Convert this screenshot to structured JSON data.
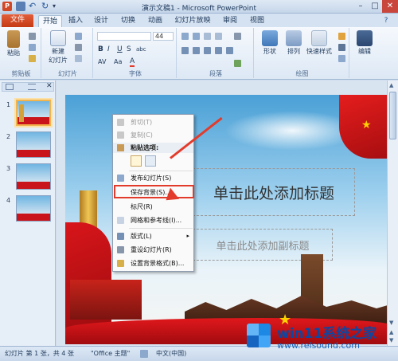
{
  "window": {
    "title": "演示文稿1 - Microsoft PowerPoint"
  },
  "tabs": [
    "文件",
    "开始",
    "插入",
    "设计",
    "切换",
    "动画",
    "幻灯片放映",
    "审阅",
    "视图"
  ],
  "ribbon": {
    "clipboard": {
      "paste": "粘贴",
      "label": "剪贴板"
    },
    "slides": {
      "new_slide": "新建\n幻灯片",
      "new_slide_line1": "新建",
      "new_slide_line2": "幻灯片",
      "label": "幻灯片"
    },
    "font": {
      "size": "44",
      "label": "字体",
      "bold": "B",
      "italic": "I",
      "underline": "U",
      "strike": "S",
      "shadow": "abc",
      "spacing": "AV",
      "case": "Aa",
      "color": "A"
    },
    "paragraph": {
      "label": "段落"
    },
    "drawing": {
      "shape": "形状",
      "arrange": "排列",
      "quick_styles": "快速样式",
      "label": "绘图"
    },
    "editing": {
      "label": "编辑"
    }
  },
  "slide": {
    "title_placeholder": "单击此处添加标题",
    "subtitle_placeholder": "单击此处添加副标题"
  },
  "thumbnails": [
    "1",
    "2",
    "3",
    "4"
  ],
  "context_menu": {
    "cut": "剪切(T)",
    "copy": "复制(C)",
    "paste_options": "粘贴选项:",
    "publish_slides": "发布幻灯片(S)",
    "save_background": "保存背景(S)...",
    "ruler": "标尺(R)",
    "grid_guides": "网格和参考线(I)...",
    "layout": "版式(L)",
    "reset_slide": "重设幻灯片(R)",
    "format_background": "设置背景格式(B)..."
  },
  "status": {
    "slide_info": "幻灯片 第 1 张，共 4 张",
    "theme": "\"Office 主题\"",
    "language": "中文(中国)"
  },
  "watermark": {
    "brand": "win11系统之家",
    "url": "www.relsound.com"
  },
  "colors": {
    "file_tab": "#c43b14",
    "highlight": "#e33b2b",
    "accent_red": "#c8141a"
  }
}
